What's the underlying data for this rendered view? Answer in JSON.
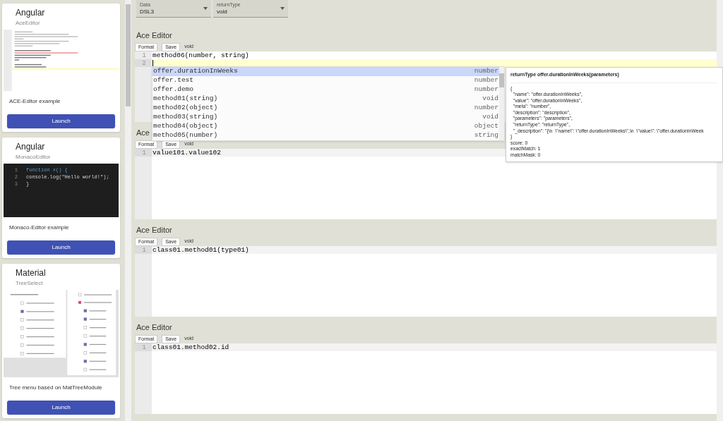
{
  "sidebar": {
    "cards": [
      {
        "title": "Angular",
        "subtitle": "AceEditor",
        "preview": {
          "kind": "ace"
        },
        "description": "ACE-Editor example",
        "button": "Launch"
      },
      {
        "title": "Angular",
        "subtitle": "MonacoEditor",
        "preview": {
          "kind": "monaco",
          "lines": [
            {
              "number": "1",
              "text": "function x() {"
            },
            {
              "number": "2",
              "text": "console.log(\"Hello world!\");"
            },
            {
              "number": "3",
              "text": "}"
            }
          ]
        },
        "description": "Monaco-Editor example",
        "button": "Launch"
      },
      {
        "title": "Material",
        "subtitle": "TreeSelect",
        "preview": {
          "kind": "tree"
        },
        "description": "Tree menu based on MatTreeModule",
        "button": "Launch"
      }
    ]
  },
  "selects": [
    {
      "label": "Data",
      "value": "DSL3"
    },
    {
      "label": "returnType",
      "value": "void"
    }
  ],
  "editors": [
    {
      "heading": "Ace Editor",
      "buttons": [
        "Format",
        "Save"
      ],
      "type": "void",
      "focused": true,
      "lines": [
        {
          "number": "1",
          "text": "method06(number, string)",
          "active": false
        },
        {
          "number": "2",
          "active": true
        }
      ]
    },
    {
      "heading": "Ace",
      "buttons": [
        "Format",
        "Save"
      ],
      "type": "void",
      "focused": false,
      "lines": [
        {
          "number": "1",
          "text": "value101.value102",
          "active": true
        }
      ]
    },
    {
      "heading": "Ace Editor",
      "buttons": [
        "Format",
        "Save"
      ],
      "type": "void",
      "focused": false,
      "lines": [
        {
          "number": "1",
          "text": "class01.method01(type01)",
          "active": true
        }
      ]
    },
    {
      "heading": "Ace Editor",
      "buttons": [
        "Format",
        "Save"
      ],
      "type": "void",
      "focused": false,
      "lines": [
        {
          "number": "1",
          "text": "class01.method02.id",
          "active": true
        }
      ]
    }
  ],
  "autocomplete": {
    "items": [
      {
        "name": "offer.durationInWeeks",
        "meta": "number",
        "selected": true
      },
      {
        "name": "offer.test",
        "meta": "number",
        "selected": false
      },
      {
        "name": "offer.demo",
        "meta": "number",
        "selected": false
      },
      {
        "name": "method01(string)",
        "meta": "void",
        "selected": false
      },
      {
        "name": "method02(object)",
        "meta": "number",
        "selected": false
      },
      {
        "name": "method03(string)",
        "meta": "void",
        "selected": false
      },
      {
        "name": "method04(object)",
        "meta": "object",
        "selected": false
      },
      {
        "name": "method05(number)",
        "meta": "string",
        "selected": false
      }
    ]
  },
  "tooltip": {
    "title": "returnType offer.durationInWeeks(parameters)",
    "lines": [
      "{",
      "  \"name\": \"offer.durationInWeeks\",",
      "  \"value\": \"offer.durationInWeeks\",",
      "  \"meta\": \"number\",",
      "  \"description\": \"description\",",
      "  \"parameters\": \"parameters\",",
      "  \"returnType\": \"returnType\",",
      "  \"_description\": \"{\\n  \\\"name\\\": \\\"offer.durationInWeeks\\\",\\n  \\\"value\\\": \\\"offer.durationInWeek",
      "}",
      "score: 0",
      "exactMatch: 1",
      "matchMask: 0"
    ]
  }
}
